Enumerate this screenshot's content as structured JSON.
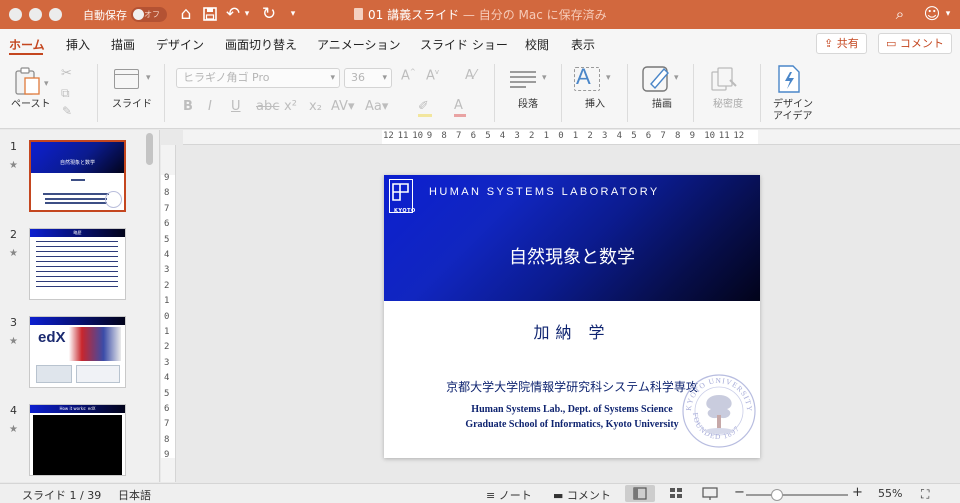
{
  "titlebar": {
    "autosave_label": "自動保存",
    "autosave_state": "オフ",
    "doc_name": "01 講義スライド",
    "doc_location": "— 自分の Mac に保存済み",
    "color": "#d2683e"
  },
  "ribbon": {
    "tabs": [
      "ホーム",
      "挿入",
      "描画",
      "デザイン",
      "画面切り替え",
      "アニメーション",
      "スライド ショー",
      "校閲",
      "表示"
    ],
    "active_tab": "ホーム",
    "share_label": "共有",
    "comment_label": "コメント",
    "paste_label": "ペースト",
    "slide_label": "スライド",
    "font_name": "ヒラギノ角ゴ Pro",
    "font_size": "36",
    "paragraph_label": "段落",
    "insert_label": "挿入",
    "draw_label": "描画",
    "sensitivity_label": "秘密度",
    "design_idea_label1": "デザイン",
    "design_idea_label2": "アイデア"
  },
  "thumbnails": [
    {
      "number": "1",
      "title": "自然現象と数学",
      "selected": true
    },
    {
      "number": "2",
      "title": "略歴",
      "selected": false
    },
    {
      "number": "3",
      "title": "edX",
      "selected": false
    },
    {
      "number": "4",
      "title": "How it works: edX",
      "selected": false
    }
  ],
  "ruler": {
    "horizontal": [
      "12",
      "11",
      "10",
      "9",
      "8",
      "7",
      "6",
      "5",
      "4",
      "3",
      "2",
      "1",
      "0",
      "1",
      "2",
      "3",
      "4",
      "5",
      "6",
      "7",
      "8",
      "9",
      "10",
      "11",
      "12"
    ],
    "vertical": [
      "9",
      "8",
      "7",
      "6",
      "5",
      "4",
      "3",
      "2",
      "1",
      "0",
      "1",
      "2",
      "3",
      "4",
      "5",
      "6",
      "7",
      "8",
      "9"
    ]
  },
  "slide": {
    "lab_name": "HUMAN SYSTEMS LABORATORY",
    "logo_text": "KYOTO",
    "title": "自然現象と数学",
    "author": "加納 学",
    "affiliation_ja": "京都大学大学院情報学研究科システム科学専攻",
    "affiliation_en1": "Human Systems Lab., Dept. of Systems Science",
    "affiliation_en2": "Graduate School of Informatics, Kyoto University",
    "seal_text": "KYOTO UNIVERSITY FOUNDED 1897"
  },
  "statusbar": {
    "slide_position": "スライド 1 / 39",
    "language": "日本語",
    "notes_label": "ノート",
    "comments_label": "コメント",
    "zoom": "55%"
  }
}
